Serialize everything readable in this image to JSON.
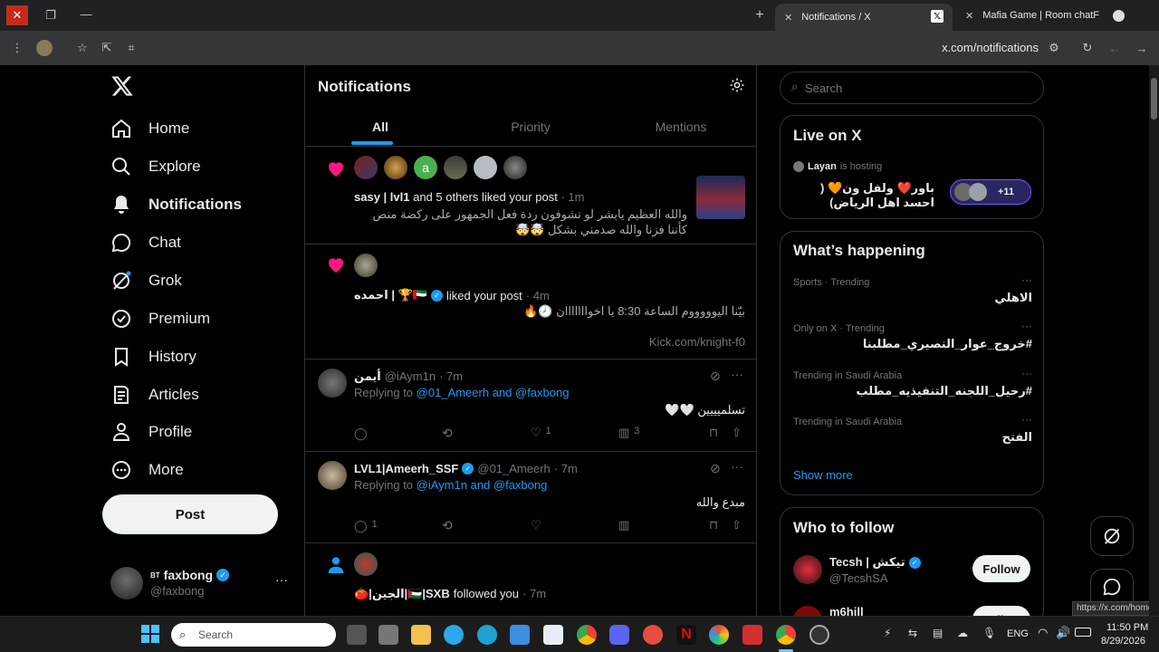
{
  "browser": {
    "tabs": [
      {
        "label": "Notifications / X"
      },
      {
        "label": "Mafia Game | Room chatF"
      }
    ],
    "url": "x.com/notifications",
    "status_url": "https://x.com/home"
  },
  "nav": {
    "items": [
      {
        "label": "Home"
      },
      {
        "label": "Explore"
      },
      {
        "label": "Notifications"
      },
      {
        "label": "Chat"
      },
      {
        "label": "Grok"
      },
      {
        "label": "Premium"
      },
      {
        "label": "History"
      },
      {
        "label": "Articles"
      },
      {
        "label": "Profile"
      },
      {
        "label": "More"
      }
    ],
    "post_label": "Post",
    "account": {
      "name": "faxbong",
      "handle": "@faxbong",
      "prefix": "BT"
    }
  },
  "header": {
    "title": "Notifications",
    "tabs": [
      {
        "label": "All"
      },
      {
        "label": "Priority"
      },
      {
        "label": "Mentions"
      }
    ]
  },
  "notifications": {
    "n1": {
      "actor": "sasy | lvl1",
      "action": "and 5 others liked your post",
      "time": "· 1m",
      "text": "والله العظيم يابشر لو تشوفون ردة فعل الجمهور على ركضة منص كأننا فزنا والله صدمني بشكل 🤯🤯",
      "avatar_letter": "a"
    },
    "n2": {
      "actor": "احمده | 🏆🇦🇪",
      "action": "liked your post",
      "time": "· 4m",
      "text": "بيّنا اليوووووم الساعة 8:30 يا اخوااااااان 🕗🔥",
      "link": "Kick.com/knight-f0"
    },
    "n3": {
      "name": "أيمن",
      "handle": "@iAym1n",
      "time": "· 7m",
      "replying_prefix": "Replying to",
      "replying_to": "@01_Ameerh and @faxbong",
      "text": "تسلميييين 🤍🤍",
      "likes": "1",
      "views": "3"
    },
    "n4": {
      "name": "LVL1|Ameerh_SSF",
      "handle": "@01_Ameerh",
      "time": "· 7m",
      "replying_prefix": "Replying to",
      "replying_to": "@iAym1n and @faxbong",
      "text": "مبدع والله",
      "replies": "1"
    },
    "n5": {
      "actor": "🍅|الجين|🇵🇸|SXB",
      "action": "followed you",
      "time": "· 7m"
    }
  },
  "search": {
    "placeholder": "Search"
  },
  "live": {
    "title": "Live on X",
    "host": "Layan",
    "hosting": "is hosting",
    "room_title": "باور❤️ ولفل ون🧡 ( احسد اهل الرياض)",
    "count": "+11"
  },
  "happening": {
    "title": "What’s happening",
    "trends": [
      {
        "context": "Sports · Trending",
        "name": "الاهلي"
      },
      {
        "context": "Only on X · Trending",
        "name": "#خروج_عوار_النصيري_مطلبنا"
      },
      {
        "context": "Trending in Saudi Arabia",
        "name": "#رحيل_اللجنه_التنفيذيه_مطلب"
      },
      {
        "context": "Trending in Saudi Arabia",
        "name": "الفتح"
      }
    ],
    "show_more": "Show more"
  },
  "who_to_follow": {
    "title": "Who to follow",
    "users": [
      {
        "name": "Tecsh | تيكش",
        "handle": "@TecshSA",
        "button": "Follow"
      },
      {
        "name": "m6hjll",
        "handle": "",
        "button": "Follow"
      }
    ]
  },
  "taskbar": {
    "search_placeholder": "Search",
    "lang": "ENG",
    "time": "11:50 PM",
    "date": "8/29/2026"
  }
}
